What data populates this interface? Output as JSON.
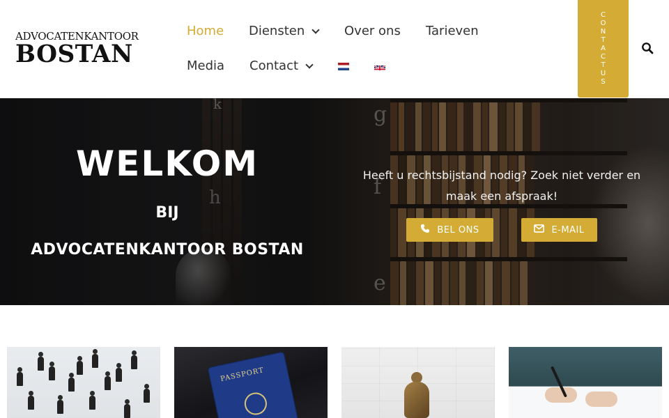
{
  "header": {
    "logo_top": "ADVOCATENKANTOOR",
    "logo_main": "BOSTAN",
    "nav": [
      {
        "label": "Home",
        "active": true
      },
      {
        "label": "Diensten",
        "has_dropdown": true
      },
      {
        "label": "Over ons"
      },
      {
        "label": "Tarieven"
      },
      {
        "label": "Media"
      },
      {
        "label": "Contact",
        "has_dropdown": true
      }
    ],
    "languages": [
      {
        "code": "nl",
        "icon": "flag-netherlands-icon"
      },
      {
        "code": "en",
        "icon": "flag-united-kingdom-icon"
      }
    ],
    "cta_label": "CONTACTUS",
    "search_icon": "search-icon"
  },
  "hero": {
    "title": "WELKOM",
    "subtitle": "BIJ",
    "firm": "ADVOCATENKANTOOR BOSTAN",
    "text": "Heeft u rechtsbijstand nodig? Zoek niet verder en maak een afspraak!",
    "buttons": [
      {
        "label": "BEL ONS",
        "icon": "phone-icon"
      },
      {
        "label": "E-MAIL",
        "icon": "envelope-icon"
      }
    ],
    "letters": [
      "k",
      "g",
      "h",
      "f",
      "e"
    ]
  },
  "cards": [
    {
      "image": "crowd-walking-image"
    },
    {
      "image": "passport-image"
    },
    {
      "image": "thinker-statue-image"
    },
    {
      "image": "signing-document-image"
    }
  ],
  "colors": {
    "accent": "#d4ac35",
    "nav_text": "#333333",
    "hero_text": "#ffffff"
  }
}
